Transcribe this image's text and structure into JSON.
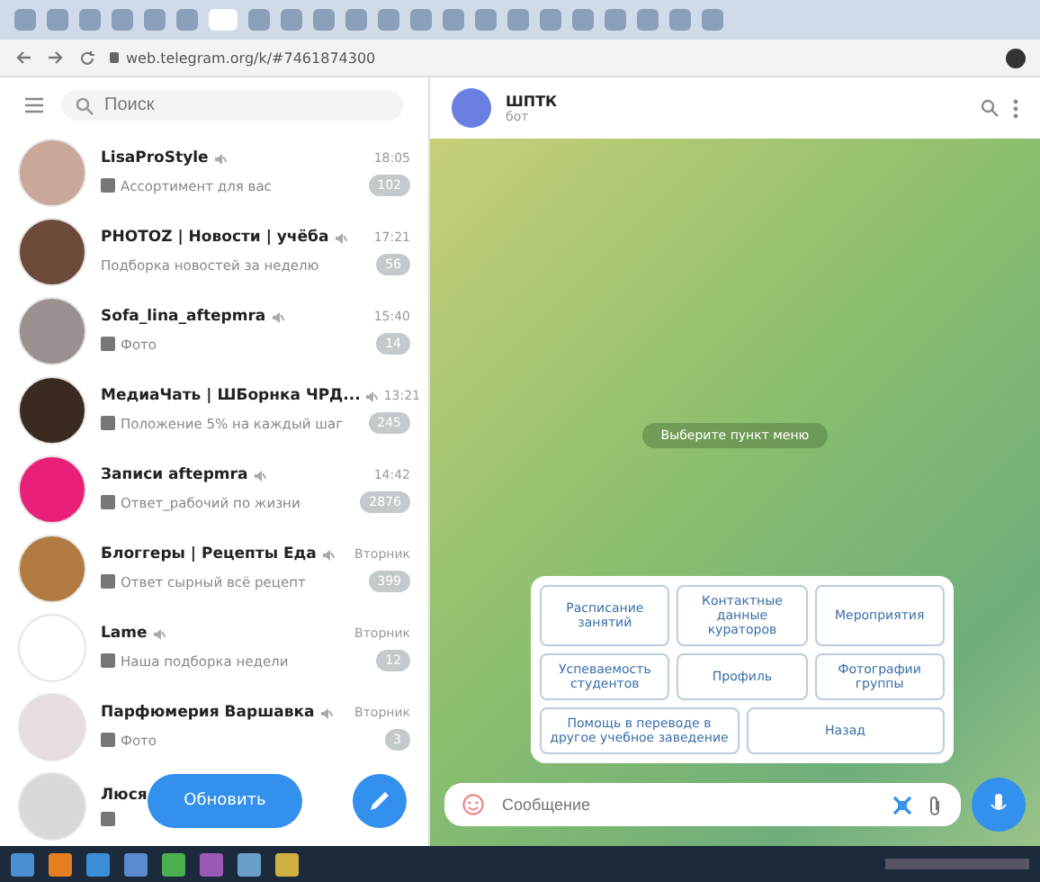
{
  "browser": {
    "url": "web.telegram.org/k/#7461874300"
  },
  "sidebar": {
    "search": {
      "placeholder": "Поиск"
    },
    "chats": [
      {
        "name": "LisaProStyle",
        "preview": "Ассортимент для вас",
        "time": "18:05",
        "unread": "102",
        "color": "#c9a89a",
        "media": true,
        "muted": true
      },
      {
        "name": "PHOTOZ | Новости | учёба",
        "preview": "Подборка новостей за неделю",
        "time": "17:21",
        "unread": "56",
        "color": "#6b4a3a",
        "media": false,
        "muted": true
      },
      {
        "name": "Sofa_lina_aftepmra",
        "preview": "Фото",
        "time": "15:40",
        "unread": "14",
        "color": "#9a9090",
        "media": true,
        "muted": true
      },
      {
        "name": "МедиаЧать | ШБорнка ЧРД...",
        "preview": "Положение 5% на каждый шаг",
        "time": "13:21",
        "unread": "245",
        "color": "#3a2a20",
        "media": true,
        "muted": true
      },
      {
        "name": "Записи aftepmra",
        "preview": "Ответ_рабочий по жизни",
        "time": "14:42",
        "unread": "2876",
        "color": "#e8207a",
        "media": true,
        "muted": true
      },
      {
        "name": "Блоггеры | Рецепты Еда",
        "preview": "Ответ сырный всё рецепт",
        "time": "Вторник",
        "unread": "399",
        "color": "#b07a40",
        "media": true,
        "muted": true
      },
      {
        "name": "Lame",
        "preview": "Наша подборка недели",
        "time": "Вторник",
        "unread": "12",
        "color": "#ffffff",
        "media": true,
        "muted": true
      },
      {
        "name": "Парфюмерия Варшавка",
        "preview": "Фото",
        "time": "Вторник",
        "unread": "3",
        "color": "#e6dede",
        "media": true,
        "muted": true
      },
      {
        "name": "Люся",
        "color": "#d8d8d8",
        "media": true,
        "muted": false
      }
    ],
    "update_button": "Обновить"
  },
  "chat": {
    "title": "ШПТК",
    "subtitle": "бот",
    "service_message": "Выберите пункт меню",
    "keyboard": [
      [
        "Расписание занятий",
        "Контактные данные кураторов",
        "Мероприятия"
      ],
      [
        "Успеваемость студентов",
        "Профиль",
        "Фотографии группы"
      ],
      [
        "Помощь в переводе в другое учебное заведение",
        "Назад"
      ]
    ],
    "input": {
      "placeholder": "Сообщение"
    }
  }
}
